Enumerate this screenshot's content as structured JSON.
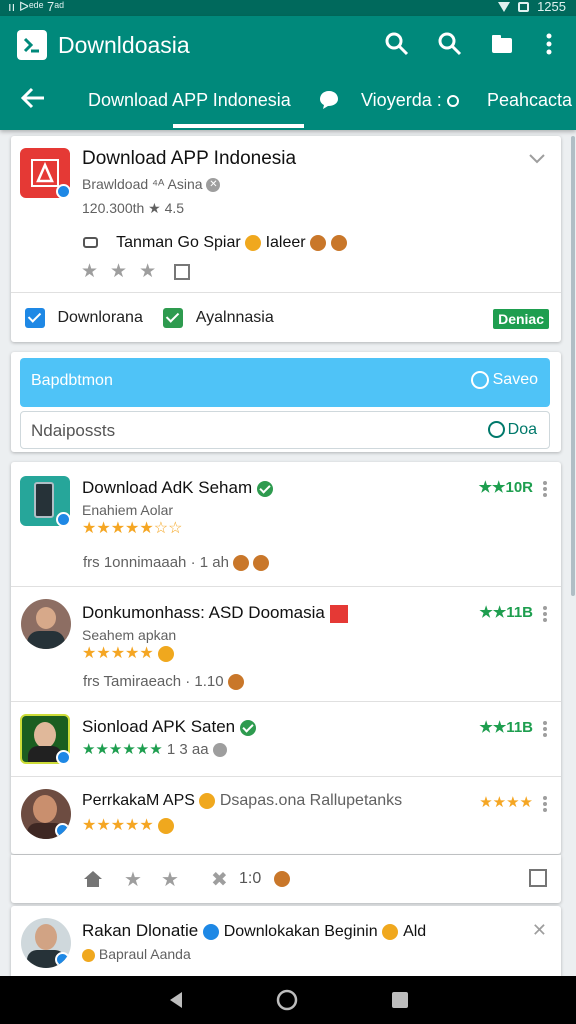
{
  "status": {
    "left": "ıı ᐅᵉᵈᵉ 7ᵃᵈ",
    "time": "1255"
  },
  "appbar": {
    "title": "Downldoasia",
    "tabs": [
      "Download APP Indonesia",
      "Vioyerda :",
      "Peahcacta"
    ],
    "icons": [
      "search-icon",
      "search-icon",
      "folder-icon",
      "more-vert-icon"
    ]
  },
  "featured": {
    "title": "Download APP Indonesia",
    "publisher": "Brawldoad ⁴ᴬ Asina",
    "meta": "120.300th ★ 4.5",
    "tagline": "Tanman Go Spiar",
    "tagline_suffix": "Ialeer",
    "chip1": "Downlorana",
    "chip2": "Ayalnnasia",
    "badge": "Deniac",
    "accent": "#e53935"
  },
  "search": {
    "bar_label": "Bapdbtmon",
    "save_label": "Saveo",
    "input_placeholder": "Ndaipossts",
    "go_label": "Doa",
    "bar_color": "#4fc3f7"
  },
  "list": [
    {
      "title": "Download AdK Seham",
      "subtitle": "Enahiem Aolar",
      "stars": "★★★★★☆☆",
      "rating": "★★10R",
      "extra": "frs   1onnimaaah · 1 ah"
    },
    {
      "title": "Donkumonhass: ASD Doomasia",
      "subtitle": "Seahem apkan",
      "stars": "★★★★★",
      "rating": "★★11B",
      "extra": "frs   Tamiraeach · 1.10"
    },
    {
      "title": "Sionload APK Saten",
      "subtitle": "1 3 aa",
      "stars": "★★★★★★",
      "rating": "★★11B",
      "extra": ""
    },
    {
      "title": "PerrkakaM APS",
      "subtitle_right": "Dsapas.ona Rallupetanks",
      "stars": "★★★★★",
      "rating": "★★★★",
      "extra": ""
    }
  ],
  "actions_row": {
    "count": "1:0"
  },
  "last": {
    "title": "Rakan Dlonatie",
    "title_right": "Downlokakan Beginin",
    "title_tail": "Ald",
    "subtitle": "Bapraul Aanda"
  }
}
